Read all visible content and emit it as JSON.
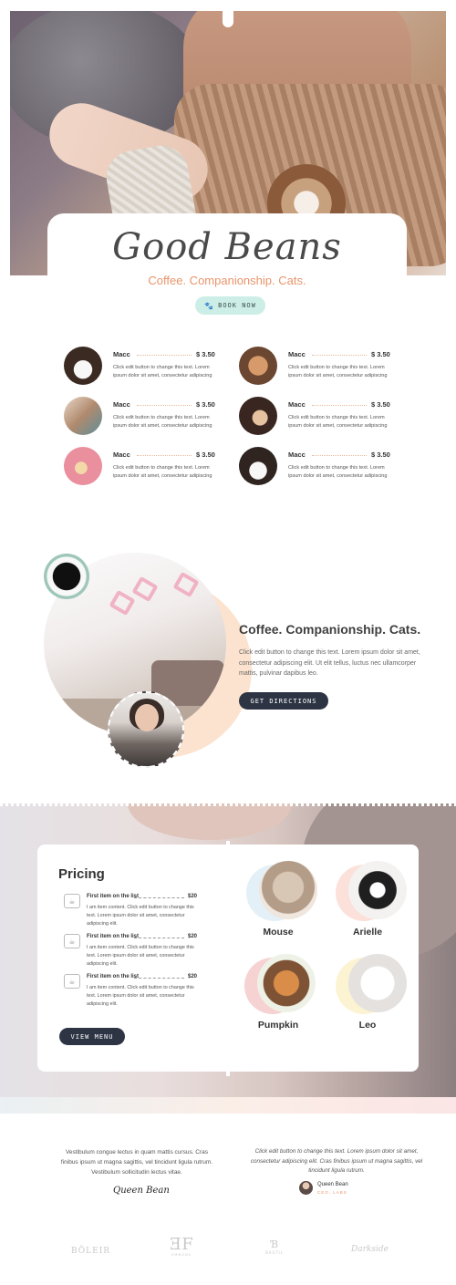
{
  "hero": {
    "title": "Good Beans",
    "subtitle": "Coffee. Companionship. Cats.",
    "book_button": "BOOK NOW",
    "book_icon": "paw-icon"
  },
  "menu": {
    "items": [
      {
        "name": "Macc",
        "price": "$ 3.50",
        "description": "Click edit button to change this text. Lorem ipsum dolor sit amet, consectetur adipiscing"
      },
      {
        "name": "Macc",
        "price": "$ 3.50",
        "description": "Click edit button to change this text. Lorem ipsum dolor sit amet, consectetur adipiscing"
      },
      {
        "name": "Macc",
        "price": "$ 3.50",
        "description": "Click edit button to change this text. Lorem ipsum dolor sit amet, consectetur adipiscing"
      },
      {
        "name": "Macc",
        "price": "$ 3.50",
        "description": "Click edit button to change this text. Lorem ipsum dolor sit amet, consectetur adipiscing"
      },
      {
        "name": "Macc",
        "price": "$ 3.50",
        "description": "Click edit button to change this text. Lorem ipsum dolor sit amet, consectetur adipiscing"
      },
      {
        "name": "Macc",
        "price": "$ 3.50",
        "description": "Click edit button to change this text. Lorem ipsum dolor sit amet, consectetur adipiscing"
      }
    ]
  },
  "about": {
    "title": "Coffee. Companionship. Cats.",
    "text": "Click edit button to change this text. Lorem ipsum dolor sit amet, consectetur adipiscing elit. Ut elit tellus, luctus nec ullamcorper mattis, pulvinar dapibus leo.",
    "button": "GET DIRECTIONS"
  },
  "pricing": {
    "title": "Pricing",
    "items": [
      {
        "name": "First item on the list",
        "price": "$20",
        "description": "I am item content. Click edit button to change this text. Lorem ipsum dolor sit amet, consectetur adipiscing elit."
      },
      {
        "name": "First item on the list",
        "price": "$20",
        "description": "I am item content. Click edit button to change this text. Lorem ipsum dolor sit amet, consectetur adipiscing elit."
      },
      {
        "name": "First item on the list",
        "price": "$20",
        "description": "I am item content. Click edit button to change this text. Lorem ipsum dolor sit amet, consectetur adipiscing elit."
      }
    ],
    "button": "VIEW MENU"
  },
  "cats": [
    {
      "name": "Mouse"
    },
    {
      "name": "Arielle"
    },
    {
      "name": "Pumpkin"
    },
    {
      "name": "Leo"
    }
  ],
  "testimonial": {
    "left_text": "Vestibulum congue lectus in quam mattis cursus. Cras finibus ipsum ut magna sagittis, vel tincidunt ligula rutrum. Vestibulum sollicitudin lectus vitae.",
    "signature": "Queen Bean",
    "quote": "Click edit button to change this text. Lorem ipsum dolor sit amet, consectetur adipiscing elit. Cras finibus ipsum ut magna sagittis, vel tincidunt ligula rutrum.",
    "author_name": "Queen Bean",
    "author_role": "CEO, LABS"
  },
  "logos": [
    "BÖLEIR",
    "EMMONS",
    "BASTIL",
    "Darkside"
  ],
  "colors": {
    "accent": "#e8946b",
    "dark_button": "#2d3443",
    "mint_button": "#cdeee6",
    "peach": "#fbe3cf"
  }
}
